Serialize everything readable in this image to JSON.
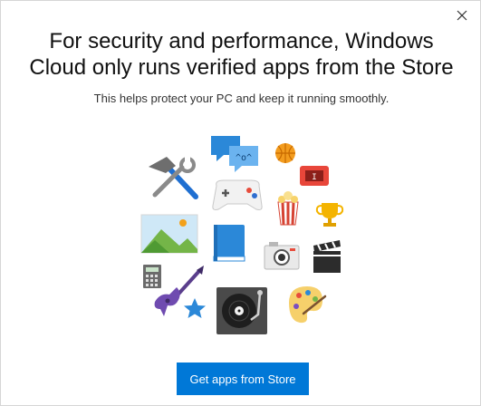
{
  "dialog": {
    "close_icon": "close-icon",
    "heading_line1": "For security and performance, Windows",
    "heading_line2": "Cloud only runs verified apps from the Store",
    "subtitle": "This helps protect your PC and keep it running smoothly.",
    "cta_label": "Get apps from Store"
  },
  "illustration": {
    "chat_bubble_text": "^o^",
    "icons": [
      "tools-icon",
      "chat-icon",
      "basketball-icon",
      "ticket-icon",
      "gamepad-icon",
      "popcorn-icon",
      "trophy-icon",
      "picture-icon",
      "book-icon",
      "camera-icon",
      "clapperboard-icon",
      "calculator-icon",
      "guitar-icon",
      "star-icon",
      "turntable-icon",
      "palette-icon"
    ]
  },
  "colors": {
    "accent": "#0078d7",
    "heading": "#111111",
    "subtitle": "#333333"
  }
}
